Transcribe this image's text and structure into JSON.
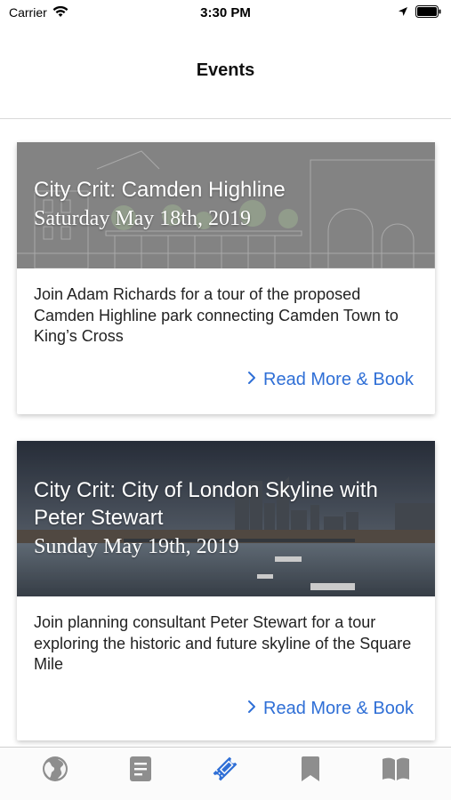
{
  "status_bar": {
    "carrier": "Carrier",
    "time": "3:30 PM"
  },
  "header": {
    "title": "Events"
  },
  "events": [
    {
      "title": "City Crit: Camden Highline",
      "date": "Saturday May 18th, 2019",
      "description": "Join Adam Richards for a tour of the proposed Camden Highline park connecting Camden Town to King’s Cross",
      "link_label": "Read More & Book"
    },
    {
      "title": "City Crit: City of London Skyline with Peter Stewart",
      "date": "Sunday May 19th, 2019",
      "description": "Join planning consultant Peter Stewart for a tour exploring the historic and future skyline of the Square Mile",
      "link_label": "Read More & Book"
    }
  ],
  "tab_bar": {
    "active_index": 2,
    "tabs": [
      {
        "icon": "globe-icon"
      },
      {
        "icon": "article-icon"
      },
      {
        "icon": "ticket-icon"
      },
      {
        "icon": "bookmark-icon"
      },
      {
        "icon": "book-icon"
      }
    ]
  },
  "colors": {
    "accent": "#2f6fd6",
    "inactive_icon": "#8e8e8e"
  }
}
